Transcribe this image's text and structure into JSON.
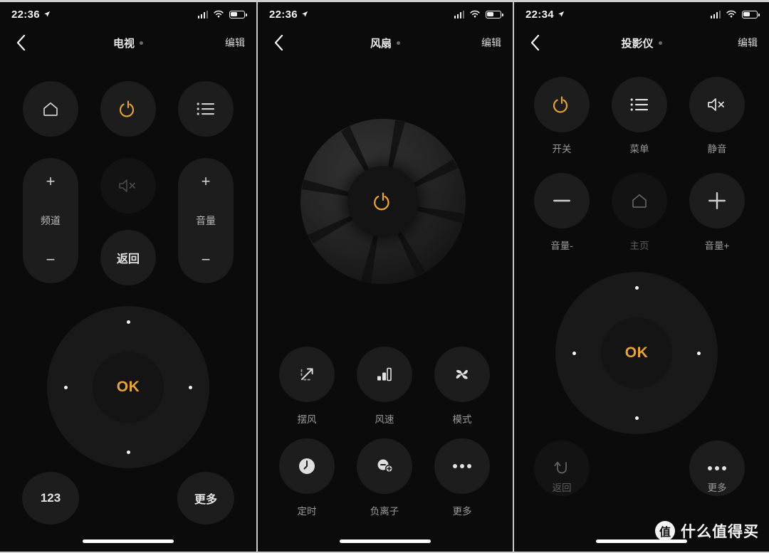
{
  "app": {
    "accent_color": "#e8a33d",
    "background": "#0b0b0b",
    "button_color": "#1d1d1d"
  },
  "watermark": {
    "logo": "值",
    "text": "什么值得买"
  },
  "panels": [
    {
      "id": "tv",
      "status": {
        "time": "22:36",
        "location_icon": "location-arrow-icon",
        "signal_icon": "cellular-signal-icon",
        "wifi_icon": "wifi-icon",
        "battery_icon": "battery-half-icon"
      },
      "nav": {
        "back": "back-chevron-icon",
        "title": "电视",
        "edit": "编辑"
      },
      "row1": [
        {
          "name": "home",
          "icon": "home-icon",
          "state": "normal"
        },
        {
          "name": "power",
          "icon": "power-icon",
          "state": "accent"
        },
        {
          "name": "menu",
          "icon": "list-menu-icon",
          "state": "normal"
        }
      ],
      "channel_pill": {
        "plus": "+",
        "label": "频道",
        "minus": "−"
      },
      "volume_pill": {
        "plus": "+",
        "label": "音量",
        "minus": "−"
      },
      "mute": {
        "icon": "mute-icon",
        "state": "disabled"
      },
      "back_button": {
        "label": "返回"
      },
      "dpad": {
        "ok": "OK",
        "up": "dpad-up-dot",
        "down": "dpad-down-dot",
        "left": "dpad-left-dot",
        "right": "dpad-right-dot"
      },
      "bottom": [
        {
          "label": "123"
        },
        {
          "label": "更多"
        }
      ]
    },
    {
      "id": "fan",
      "status": {
        "time": "22:36",
        "location_icon": "location-arrow-icon",
        "signal_icon": "cellular-signal-icon",
        "wifi_icon": "wifi-icon",
        "battery_icon": "battery-half-icon"
      },
      "nav": {
        "back": "back-chevron-icon",
        "title": "风扇",
        "edit": "编辑"
      },
      "dial": {
        "icon": "power-icon",
        "blades": 8
      },
      "grid": [
        {
          "label": "摆风",
          "icon": "swing-arrow-icon"
        },
        {
          "label": "风速",
          "icon": "fan-speed-bars-icon"
        },
        {
          "label": "模式",
          "icon": "fan-blades-icon"
        },
        {
          "label": "定时",
          "icon": "clock-icon"
        },
        {
          "label": "负离子",
          "icon": "anion-icon"
        },
        {
          "label": "更多",
          "icon": "ellipsis-icon"
        }
      ]
    },
    {
      "id": "projector",
      "status": {
        "time": "22:34",
        "location_icon": "location-arrow-icon",
        "signal_icon": "cellular-signal-icon",
        "wifi_icon": "wifi-icon",
        "battery_icon": "battery-half-icon"
      },
      "nav": {
        "back": "back-chevron-icon",
        "title": "投影仪",
        "edit": "编辑"
      },
      "grid": [
        {
          "label": "开关",
          "icon": "power-icon",
          "state": "accent"
        },
        {
          "label": "菜单",
          "icon": "list-menu-icon",
          "state": "normal"
        },
        {
          "label": "静音",
          "icon": "mute-icon",
          "state": "normal"
        },
        {
          "label": "音量-",
          "icon": "minus-icon",
          "state": "normal"
        },
        {
          "label": "主页",
          "icon": "home-icon",
          "state": "disabled"
        },
        {
          "label": "音量+",
          "icon": "plus-icon",
          "state": "normal"
        }
      ],
      "dpad": {
        "ok": "OK",
        "up": "dpad-up-dot",
        "down": "dpad-down-dot",
        "left": "dpad-left-dot",
        "right": "dpad-right-dot"
      },
      "bottom": [
        {
          "label": "返回",
          "icon": "return-arrow-icon",
          "state": "disabled"
        },
        {
          "label": "更多",
          "icon": "ellipsis-icon",
          "state": "normal"
        }
      ]
    }
  ]
}
